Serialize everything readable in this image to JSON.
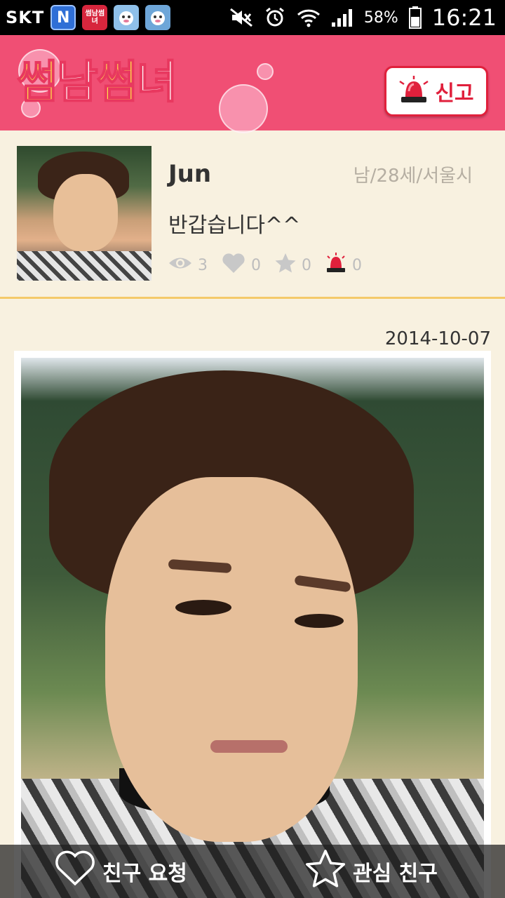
{
  "status_bar": {
    "carrier": "SKT",
    "app_icon_n": "N",
    "app_icon_sn": "썸남썸녀",
    "battery": "58%",
    "time": "16:21"
  },
  "header": {
    "logo": [
      "썸",
      "남",
      "썸",
      "녀"
    ],
    "report_label": "신고"
  },
  "profile": {
    "name": "Jun",
    "info": "남/28세/서울시",
    "greeting": "반갑습니다^^",
    "stats": {
      "views": "3",
      "likes": "0",
      "favorites": "0",
      "reports": "0"
    }
  },
  "post": {
    "date": "2014-10-07"
  },
  "actions": {
    "friend_request": "친구 요청",
    "interested_friend": "관심 친구"
  },
  "colors": {
    "header": "#f04f74",
    "background": "#f8f1e0",
    "divider": "#f4c96a",
    "report_red": "#e0203c"
  }
}
